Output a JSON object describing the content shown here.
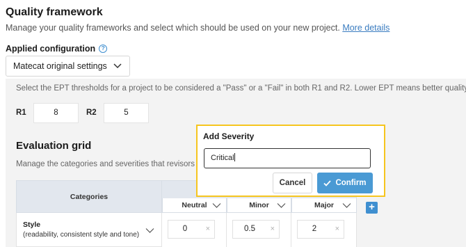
{
  "header": {
    "title": "Quality framework",
    "subtitle": "Manage your quality frameworks and select which should be used on your new project.",
    "more_link": "More details"
  },
  "config": {
    "label": "Applied configuration",
    "help_icon": "question-circle-icon",
    "selected": "Matecat original settings"
  },
  "ept": {
    "description": "Select the EPT thresholds for a project to be considered a \"Pass\" or a \"Fail\" in both R1 and R2. Lower EPT means better quality.",
    "r1_label": "R1",
    "r1_value": "8",
    "r2_label": "R2",
    "r2_value": "5"
  },
  "evaluation": {
    "title": "Evaluation grid",
    "subtitle": "Manage the categories and severities that revisors ca",
    "categories_header": "Categories",
    "severities": [
      {
        "label": "Neutral"
      },
      {
        "label": "Minor"
      },
      {
        "label": "Major"
      }
    ],
    "rows": [
      {
        "name": "Style",
        "description": "(readability, consistent style and tone)",
        "values": [
          "0",
          "0.5",
          "2"
        ]
      }
    ]
  },
  "modal": {
    "title": "Add Severity",
    "input_value": "Critical",
    "cancel_label": "Cancel",
    "confirm_label": "Confirm"
  },
  "colors": {
    "accent": "#3f8fd0",
    "confirm": "#4a9ad4",
    "highlight_border": "#f6c51e",
    "panel_bg": "#f3f3f3",
    "table_header_bg": "#e2e7ee"
  }
}
